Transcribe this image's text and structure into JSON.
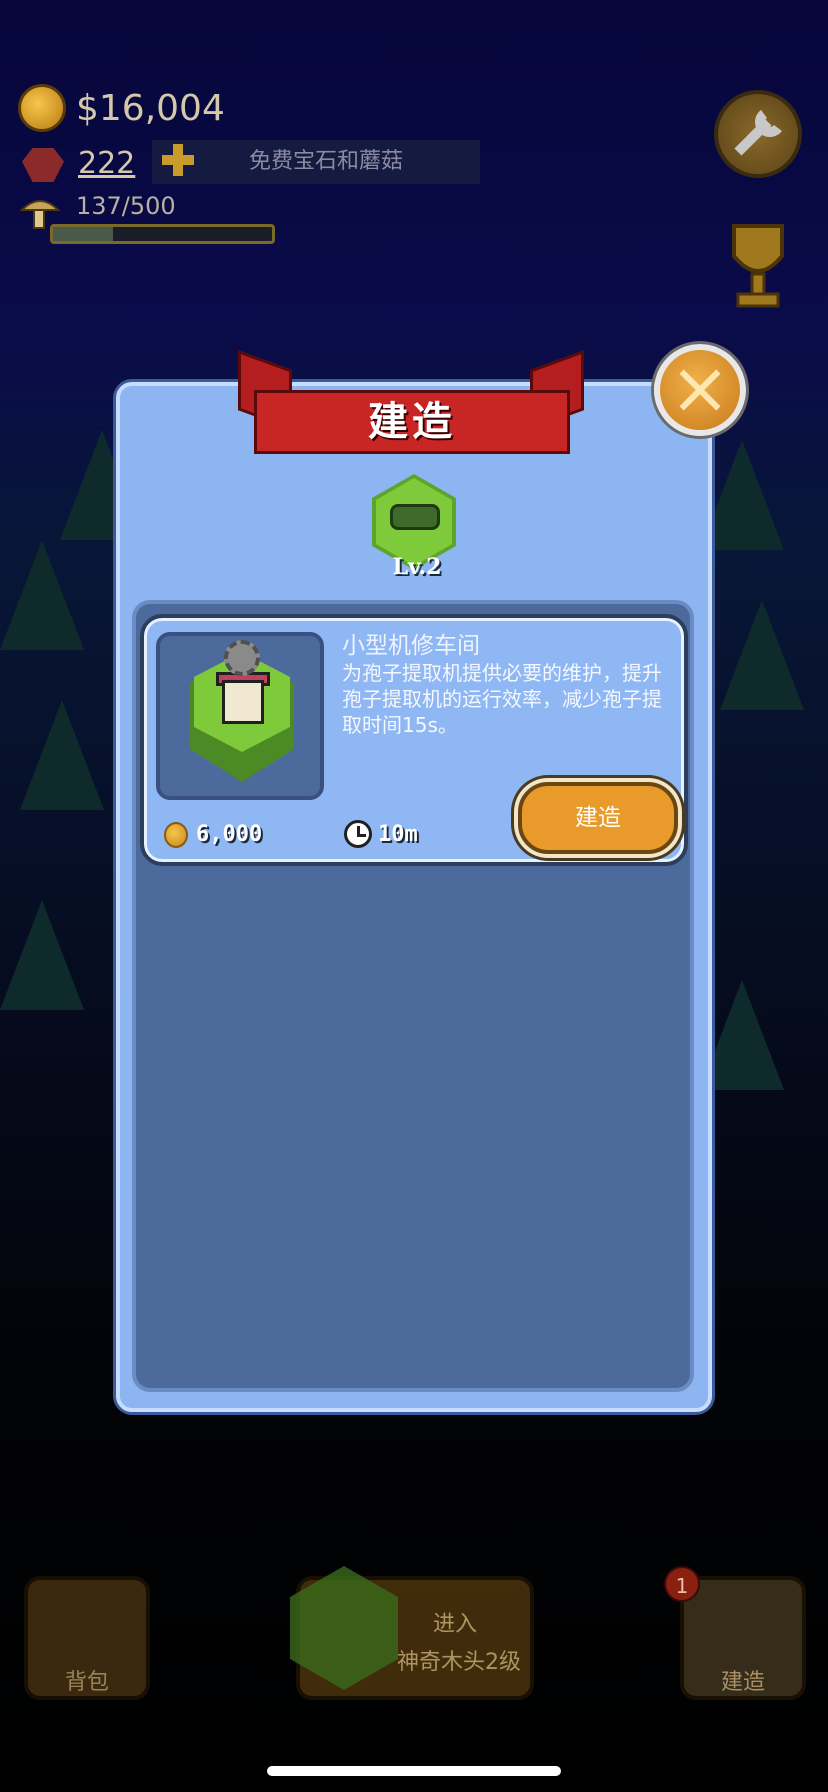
{
  "hud": {
    "money": "$16,004",
    "gems": "222",
    "free_gems_label": "免费宝石和蘑菇",
    "spores": "137/500",
    "spores_fraction": 0.274
  },
  "modal": {
    "title": "建造",
    "level": "Lv.2",
    "item": {
      "name": "小型机修车间",
      "description": "为孢子提取机提供必要的维护，提升孢子提取机的运行效率，减少孢子提取时间15s。",
      "cost": "6,000",
      "time": "10m",
      "build_label": "建造"
    }
  },
  "bottom_bar": {
    "bag_label": "背包",
    "enter_label": "进入",
    "enter_sub": "神奇木头2级",
    "build_label": "建造",
    "build_badge": "1"
  },
  "colors": {
    "modal_bg": "#8cb5f2",
    "banner": "#c82525",
    "build_button": "#e89a2a",
    "panel": "#4d6a9c"
  }
}
